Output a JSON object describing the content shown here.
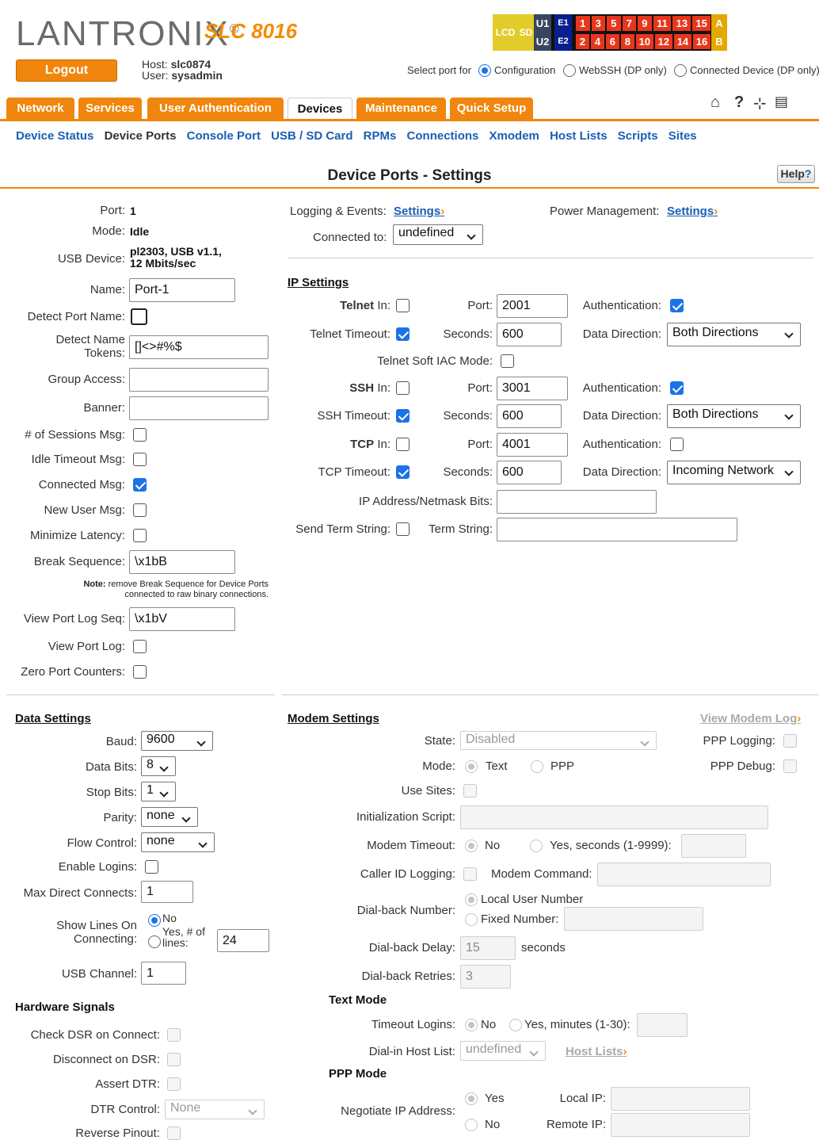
{
  "header": {
    "brand": "LANTRONIX",
    "brand_reg": "®",
    "model": "SLC 8016",
    "logout_label": "Logout",
    "host_label": "Host:",
    "host_value": "slc0874",
    "user_label": "User:",
    "user_value": "sysadmin",
    "select_port_label": "Select port for",
    "port_options": [
      "Configuration",
      "WebSSH (DP only)",
      "Connected Device (DP only)"
    ],
    "port_panel": {
      "lcd": "LCD",
      "sd": "SD",
      "u1": "U1",
      "u2": "U2",
      "e1": "E1",
      "e2": "E2",
      "top_ports": [
        "1",
        "3",
        "5",
        "7",
        "9",
        "11",
        "13",
        "15"
      ],
      "bottom_ports": [
        "2",
        "4",
        "6",
        "8",
        "10",
        "12",
        "14",
        "16"
      ],
      "a": "A",
      "b": "B"
    }
  },
  "tabs": [
    "Network",
    "Services",
    "User Authentication",
    "Devices",
    "Maintenance",
    "Quick Setup"
  ],
  "active_tab": "Devices",
  "subnav": [
    "Device Status",
    "Device Ports",
    "Console Port",
    "USB / SD Card",
    "RPMs",
    "Connections",
    "Xmodem",
    "Host Lists",
    "Scripts",
    "Sites"
  ],
  "page_title": "Device Ports - Settings",
  "help_label": "Help",
  "help_q": "?",
  "port_info": {
    "port_label": "Port:",
    "port_value": "1",
    "mode_label": "Mode:",
    "mode_value": "Idle",
    "usb_label": "USB Device:",
    "usb_value_1": "pl2303, USB v1.1,",
    "usb_value_2": "12 Mbits/sec",
    "name_label": "Name:",
    "name_value": "Port-1",
    "detect_label": "Detect Port Name:",
    "tokens_label_1": "Detect Name",
    "tokens_label_2": "Tokens:",
    "tokens_value": "[]<>#%$",
    "group_label": "Group Access:",
    "banner_label": "Banner:",
    "sessions_label": "# of Sessions Msg:",
    "idle_label": "Idle Timeout Msg:",
    "connected_label": "Connected Msg:",
    "newuser_label": "New User Msg:",
    "latency_label": "Minimize Latency:",
    "break_label": "Break Sequence:",
    "break_value": "\\x1bB",
    "note_bold": "Note:",
    "note_1": "remove Break Sequence for Device Ports",
    "note_2": "connected to raw binary connections.",
    "viewseq_label": "View Port Log Seq:",
    "viewseq_value": "\\x1bV",
    "viewlog_label": "View Port Log:",
    "zero_label": "Zero Port Counters:"
  },
  "logging": {
    "logging_label": "Logging & Events:",
    "logging_link": "Settings",
    "power_label": "Power Management:",
    "power_link": "Settings",
    "connected_label": "Connected to:",
    "connected_value": "undefined"
  },
  "ip": {
    "title": "IP Settings",
    "telnet_bold": "Telnet",
    "in_label": "In:",
    "port_label": "Port:",
    "telnet_port": "2001",
    "auth_label": "Authentication:",
    "telnet_timeout_label": "Telnet Timeout:",
    "seconds_label": "Seconds:",
    "telnet_seconds": "600",
    "data_dir_label": "Data Direction:",
    "telnet_dir": "Both Directions",
    "soft_iac_label": "Telnet Soft IAC Mode:",
    "ssh_bold": "SSH",
    "ssh_port": "3001",
    "ssh_timeout_label": "SSH Timeout:",
    "ssh_seconds": "600",
    "ssh_dir": "Both Directions",
    "tcp_bold": "TCP",
    "tcp_port": "4001",
    "tcp_timeout_label": "TCP Timeout:",
    "tcp_seconds": "600",
    "tcp_dir": "Incoming Network",
    "ipmask_label": "IP Address/Netmask Bits:",
    "send_term_label": "Send Term String:",
    "term_label": "Term String:"
  },
  "data_settings": {
    "title": "Data Settings",
    "baud_label": "Baud:",
    "baud": "9600",
    "databits_label": "Data Bits:",
    "databits": "8",
    "stopbits_label": "Stop Bits:",
    "stopbits": "1",
    "parity_label": "Parity:",
    "parity": "none",
    "flow_label": "Flow Control:",
    "flow": "none",
    "logins_label": "Enable Logins:",
    "maxconn_label": "Max Direct Connects:",
    "maxconn": "1",
    "showlines_label_1": "Show Lines On",
    "showlines_label_2": "Connecting:",
    "no_label": "No",
    "yes_label_1": "Yes, # of",
    "yes_label_2": "lines:",
    "lines": "24",
    "usbch_label": "USB Channel:",
    "usbch": "1"
  },
  "hardware": {
    "title": "Hardware Signals",
    "dsr_check_label": "Check DSR on Connect:",
    "dsr_disc_label": "Disconnect on DSR:",
    "dtr_label": "Assert DTR:",
    "dtr_ctrl_label": "DTR Control:",
    "dtr_ctrl": "None",
    "reverse_label": "Reverse Pinout:"
  },
  "modem": {
    "title": "Modem Settings",
    "view_log": "View Modem Log",
    "state_label": "State:",
    "state": "Disabled",
    "ppp_logging_label": "PPP Logging:",
    "mode_label": "Mode:",
    "text_label": "Text",
    "ppp_label": "PPP",
    "ppp_debug_label": "PPP Debug:",
    "sites_label": "Use Sites:",
    "init_label": "Initialization Script:",
    "timeout_label": "Modem Timeout:",
    "no_label": "No",
    "yes_seconds_label": "Yes, seconds (1-9999):",
    "callerid_label": "Caller ID Logging:",
    "command_label": "Modem Command:",
    "dialback_label": "Dial-back Number:",
    "local_user_label": "Local User Number",
    "fixed_label": "Fixed Number:",
    "delay_label": "Dial-back Delay:",
    "delay": "15",
    "seconds_label": "seconds",
    "retries_label": "Dial-back Retries:",
    "retries": "3",
    "text_mode_title": "Text Mode",
    "timeout_logins_label": "Timeout Logins:",
    "yes_minutes_label": "Yes, minutes (1-30):",
    "dialin_label": "Dial-in Host List:",
    "dialin": "undefined",
    "host_lists_link": "Host Lists",
    "ppp_mode_title": "PPP Mode",
    "negotiate_label": "Negotiate IP Address:",
    "yes_label": "Yes",
    "local_ip_label": "Local IP:",
    "remote_ip_label": "Remote IP:"
  },
  "colors": {
    "accent": "#f0860d",
    "link": "#1a5fb4",
    "checkbox": "#1a73e8",
    "port_red": "#e8361c",
    "port_gold": "#e5a800"
  }
}
